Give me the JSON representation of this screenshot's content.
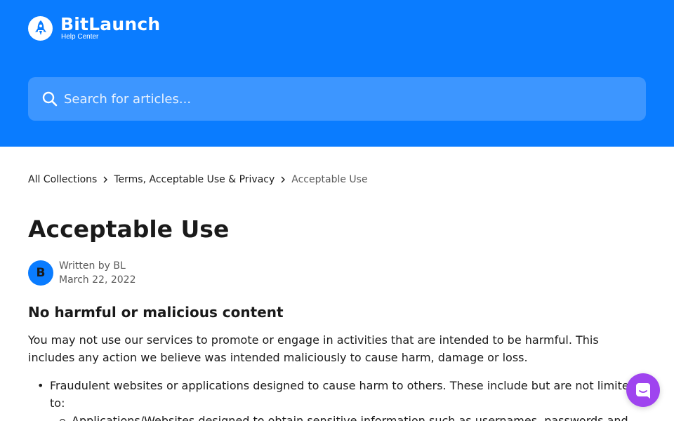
{
  "header": {
    "brand_name": "BitLaunch",
    "brand_subtitle": "Help Center",
    "logo_icon": "rocket-icon",
    "background_color": "#0a7cff"
  },
  "search": {
    "placeholder": "Search for articles...",
    "icon": "search-icon"
  },
  "breadcrumb": {
    "items": [
      {
        "label": "All Collections"
      },
      {
        "label": "Terms, Acceptable Use & Privacy"
      },
      {
        "label": "Acceptable Use"
      }
    ],
    "separator_icon": "chevron-right-icon"
  },
  "article": {
    "title": "Acceptable Use",
    "author": {
      "avatar_letter": "B",
      "written_by": "Written by BL",
      "date": "March 22, 2022",
      "avatar_color": "#0a7cff"
    },
    "section_heading": "No harmful or malicious content",
    "paragraph": "You may not use our services to promote or engage in activities that are intended to be harmful. This includes any action we believe was intended maliciously to cause harm, damage or loss.",
    "list": [
      {
        "text": "Fraudulent websites or applications designed to cause harm to others. These include but are not limited to:"
      }
    ],
    "sub_list": [
      {
        "text": "Applications/Websites designed to obtain sensitive information such as usernames, passwords and"
      }
    ]
  },
  "chat_launcher": {
    "icon": "chat-icon",
    "color": "#9f44ef"
  }
}
